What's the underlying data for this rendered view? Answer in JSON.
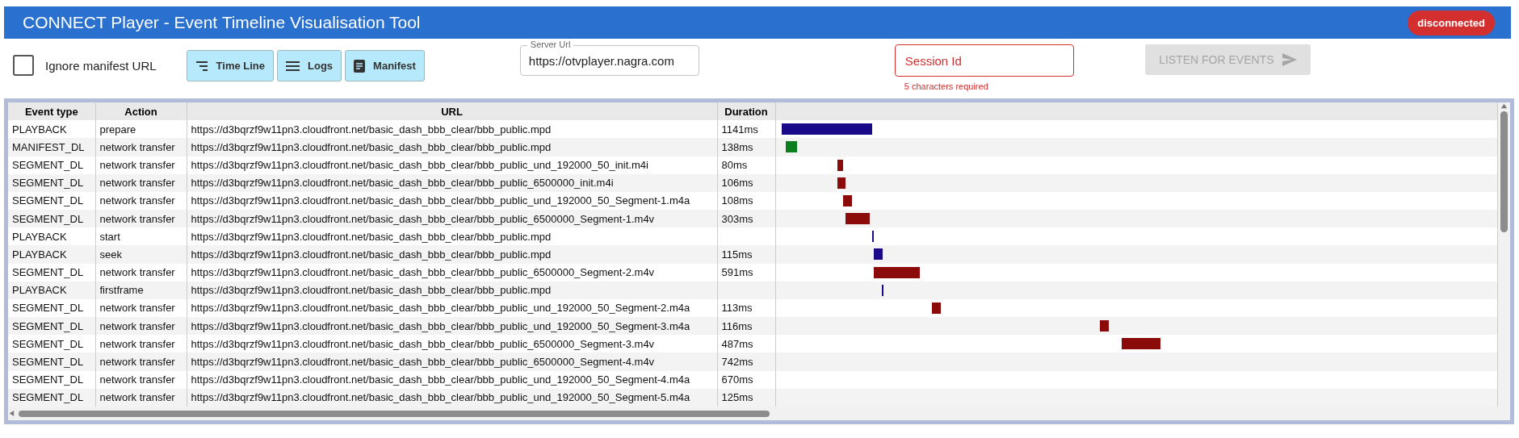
{
  "header": {
    "title": "CONNECT Player - Event Timeline Visualisation Tool",
    "status": "disconnected"
  },
  "toolbar": {
    "ignore_manifest": {
      "label": "Ignore manifest URL",
      "checked": false
    },
    "view_buttons": [
      {
        "label": "Time Line",
        "kind": "timeline"
      },
      {
        "label": "Logs",
        "kind": "logs"
      },
      {
        "label": "Manifest",
        "kind": "manifest"
      }
    ],
    "server_url": {
      "label": "Server Url",
      "value": "https://otvplayer.nagra.com"
    },
    "session_id": {
      "placeholder": "Session Id",
      "error": "5 characters required"
    },
    "listen_button": {
      "label": "LISTEN FOR EVENTS",
      "disabled": true
    }
  },
  "table": {
    "columns": [
      "Event type",
      "Action",
      "URL",
      "Duration"
    ],
    "rows": [
      {
        "event_type": "PLAYBACK",
        "action": "prepare",
        "url": "https://d3bqrzf9w11pn3.cloudfront.net/basic_dash_bbb_clear/bbb_public.mpd",
        "duration": "1141ms",
        "color": "#1a0a8a"
      },
      {
        "event_type": "MANIFEST_DL",
        "action": "network transfer",
        "url": "https://d3bqrzf9w11pn3.cloudfront.net/basic_dash_bbb_clear/bbb_public.mpd",
        "duration": "138ms",
        "color": "#0b7f1e"
      },
      {
        "event_type": "SEGMENT_DL",
        "action": "network transfer",
        "url": "https://d3bqrzf9w11pn3.cloudfront.net/basic_dash_bbb_clear/bbb_public_und_192000_50_init.m4i",
        "duration": "80ms",
        "color": "#8b0a0a"
      },
      {
        "event_type": "SEGMENT_DL",
        "action": "network transfer",
        "url": "https://d3bqrzf9w11pn3.cloudfront.net/basic_dash_bbb_clear/bbb_public_6500000_init.m4i",
        "duration": "106ms",
        "color": "#8b0a0a"
      },
      {
        "event_type": "SEGMENT_DL",
        "action": "network transfer",
        "url": "https://d3bqrzf9w11pn3.cloudfront.net/basic_dash_bbb_clear/bbb_public_und_192000_50_Segment-1.m4a",
        "duration": "108ms",
        "color": "#8b0a0a"
      },
      {
        "event_type": "SEGMENT_DL",
        "action": "network transfer",
        "url": "https://d3bqrzf9w11pn3.cloudfront.net/basic_dash_bbb_clear/bbb_public_6500000_Segment-1.m4v",
        "duration": "303ms",
        "color": "#8b0a0a"
      },
      {
        "event_type": "PLAYBACK",
        "action": "start",
        "url": "https://d3bqrzf9w11pn3.cloudfront.net/basic_dash_bbb_clear/bbb_public.mpd",
        "color": "#1a0a8a"
      },
      {
        "event_type": "PLAYBACK",
        "action": "seek",
        "url": "https://d3bqrzf9w11pn3.cloudfront.net/basic_dash_bbb_clear/bbb_public.mpd",
        "duration": "115ms",
        "color": "#1a0a8a"
      },
      {
        "event_type": "SEGMENT_DL",
        "action": "network transfer",
        "url": "https://d3bqrzf9w11pn3.cloudfront.net/basic_dash_bbb_clear/bbb_public_6500000_Segment-2.m4v",
        "duration": "591ms",
        "color": "#8b0a0a"
      },
      {
        "event_type": "PLAYBACK",
        "action": "firstframe",
        "url": "https://d3bqrzf9w11pn3.cloudfront.net/basic_dash_bbb_clear/bbb_public.mpd",
        "color": "#1a0a8a"
      },
      {
        "event_type": "SEGMENT_DL",
        "action": "network transfer",
        "url": "https://d3bqrzf9w11pn3.cloudfront.net/basic_dash_bbb_clear/bbb_public_und_192000_50_Segment-2.m4a",
        "duration": "113ms",
        "color": "#8b0a0a"
      },
      {
        "event_type": "SEGMENT_DL",
        "action": "network transfer",
        "url": "https://d3bqrzf9w11pn3.cloudfront.net/basic_dash_bbb_clear/bbb_public_und_192000_50_Segment-3.m4a",
        "duration": "116ms",
        "color": "#8b0a0a"
      },
      {
        "event_type": "SEGMENT_DL",
        "action": "network transfer",
        "url": "https://d3bqrzf9w11pn3.cloudfront.net/basic_dash_bbb_clear/bbb_public_6500000_Segment-3.m4v",
        "duration": "487ms",
        "color": "#8b0a0a"
      },
      {
        "event_type": "SEGMENT_DL",
        "action": "network transfer",
        "url": "https://d3bqrzf9w11pn3.cloudfront.net/basic_dash_bbb_clear/bbb_public_6500000_Segment-4.m4v",
        "duration": "742ms"
      },
      {
        "event_type": "SEGMENT_DL",
        "action": "network transfer",
        "url": "https://d3bqrzf9w11pn3.cloudfront.net/basic_dash_bbb_clear/bbb_public_und_192000_50_Segment-4.m4a",
        "duration": "670ms"
      },
      {
        "event_type": "SEGMENT_DL",
        "action": "network transfer",
        "url": "https://d3bqrzf9w11pn3.cloudfront.net/basic_dash_bbb_clear/bbb_public_und_192000_50_Segment-5.m4a",
        "duration": "125ms"
      }
    ]
  }
}
